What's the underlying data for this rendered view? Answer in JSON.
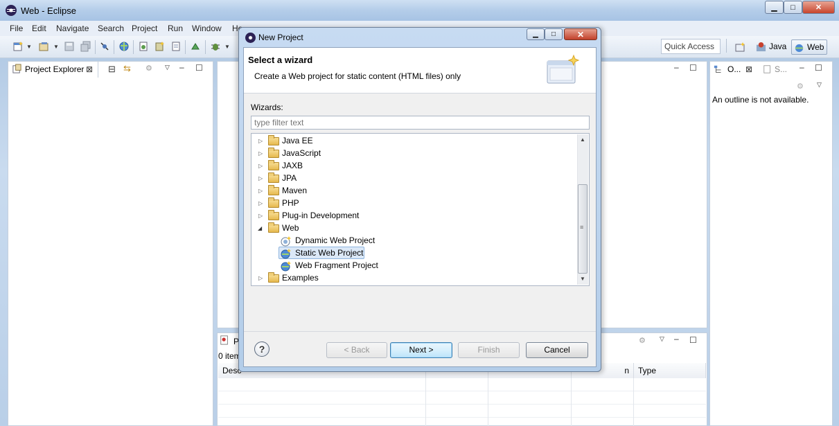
{
  "window": {
    "title": "Web - Eclipse",
    "min": "▁",
    "max": "□",
    "close": "✕"
  },
  "menu": [
    "File",
    "Edit",
    "Navigate",
    "Search",
    "Project",
    "Run",
    "Window",
    "He"
  ],
  "toolbar": {
    "quick_access": "Quick Access",
    "perspective_java": "Java",
    "perspective_web": "Web"
  },
  "project_explorer": {
    "tab_label": "Project Explorer"
  },
  "outline": {
    "tab_label": "O...",
    "snippets_label": "S...",
    "message": "An outline is not available."
  },
  "problems": {
    "tab_label": "P",
    "items_count": "0 item",
    "columns": [
      "Desc",
      "",
      "",
      "n",
      "Type"
    ]
  },
  "dialog": {
    "title": "New Project",
    "heading": "Select a wizard",
    "description": "Create a Web project for static content (HTML files) only",
    "wizards_label": "Wizards:",
    "filter_placeholder": "type filter text",
    "tree": [
      {
        "label": "Java EE",
        "kind": "folder",
        "expanded": false
      },
      {
        "label": "JavaScript",
        "kind": "folder",
        "expanded": false
      },
      {
        "label": "JAXB",
        "kind": "folder",
        "expanded": false
      },
      {
        "label": "JPA",
        "kind": "folder",
        "expanded": false
      },
      {
        "label": "Maven",
        "kind": "folder",
        "expanded": false
      },
      {
        "label": "PHP",
        "kind": "folder",
        "expanded": false
      },
      {
        "label": "Plug-in Development",
        "kind": "folder",
        "expanded": false
      },
      {
        "label": "Web",
        "kind": "folder",
        "expanded": true
      },
      {
        "label": "Dynamic Web Project",
        "kind": "wizard"
      },
      {
        "label": "Static Web Project",
        "kind": "wizard",
        "selected": true
      },
      {
        "label": "Web Fragment Project",
        "kind": "wizard"
      },
      {
        "label": "Examples",
        "kind": "folder",
        "expanded": false
      }
    ],
    "buttons": {
      "help": "?",
      "back": "< Back",
      "next": "Next >",
      "finish": "Finish",
      "cancel": "Cancel"
    },
    "close_glyph": "✕"
  }
}
